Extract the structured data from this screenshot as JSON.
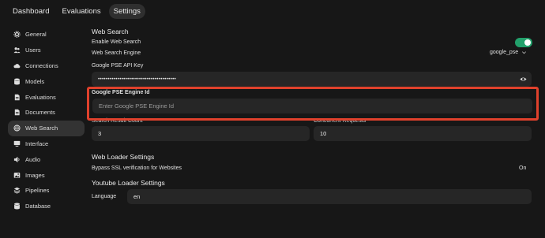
{
  "topnav": {
    "tabs": [
      {
        "label": "Dashboard"
      },
      {
        "label": "Evaluations"
      },
      {
        "label": "Settings"
      }
    ]
  },
  "sidebar": {
    "items": [
      {
        "label": "General",
        "icon": "gear-icon"
      },
      {
        "label": "Users",
        "icon": "users-icon"
      },
      {
        "label": "Connections",
        "icon": "cloud-icon"
      },
      {
        "label": "Models",
        "icon": "database-icon"
      },
      {
        "label": "Evaluations",
        "icon": "document-icon"
      },
      {
        "label": "Documents",
        "icon": "document-icon"
      },
      {
        "label": "Web Search",
        "icon": "globe-icon"
      },
      {
        "label": "Interface",
        "icon": "monitor-icon"
      },
      {
        "label": "Audio",
        "icon": "speaker-icon"
      },
      {
        "label": "Images",
        "icon": "image-icon"
      },
      {
        "label": "Pipelines",
        "icon": "pipelines-icon"
      },
      {
        "label": "Database",
        "icon": "database-icon"
      }
    ],
    "active": "Web Search"
  },
  "web_search": {
    "title": "Web Search",
    "enable_label": "Enable Web Search",
    "enabled": true,
    "engine_label": "Web Search Engine",
    "engine_value": "google_pse",
    "api_key_label": "Google PSE API Key",
    "api_key_value": "••••••••••••••••••••••••••••••••••••••••",
    "engine_id_label": "Google PSE Engine Id",
    "engine_id_placeholder": "Enter Google PSE Engine Id",
    "result_count_label": "Search Result Count",
    "result_count_value": "3",
    "concurrent_label": "Concurrent Requests",
    "concurrent_value": "10"
  },
  "web_loader": {
    "title": "Web Loader Settings",
    "bypass_label": "Bypass SSL verification for Websites",
    "bypass_value": "On"
  },
  "youtube_loader": {
    "title": "Youtube Loader Settings",
    "language_label": "Language",
    "language_value": "en"
  },
  "colors": {
    "background": "#171717",
    "field": "#262626",
    "toggle_on": "#22a06b",
    "highlight": "#e0412c"
  }
}
